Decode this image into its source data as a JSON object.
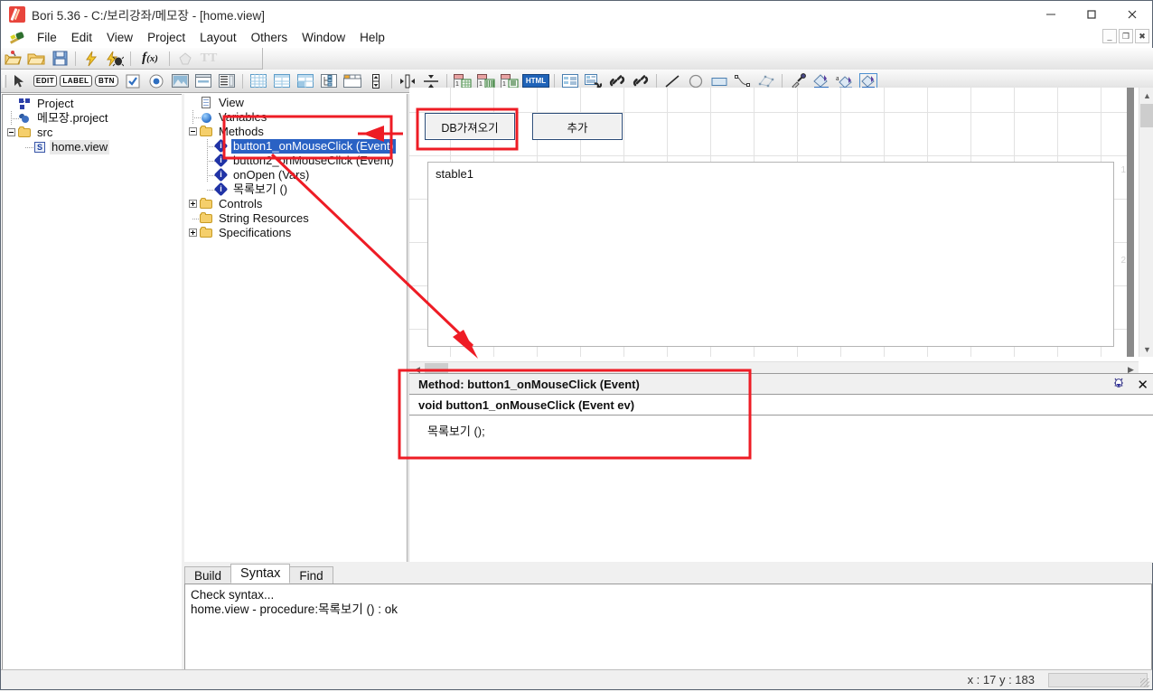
{
  "window": {
    "title": "Bori 5.36 - C:/보리강좌/메모장 - [home.view]",
    "app_icon": "bori-app-icon",
    "minimize": "–",
    "maximize": "□",
    "close": "✕",
    "mdi_minimize": "_",
    "mdi_restore": "❐",
    "mdi_close": "✖"
  },
  "menubar": {
    "icon": "bori-menu-icon",
    "items": [
      "File",
      "Edit",
      "View",
      "Project",
      "Layout",
      "Others",
      "Window",
      "Help"
    ]
  },
  "toolbar_main": [
    {
      "name": "open-project-icon",
      "glyph": "open-project"
    },
    {
      "name": "open-folder-icon",
      "glyph": "folder"
    },
    {
      "name": "save-icon",
      "glyph": "floppy"
    },
    {
      "name": "separator",
      "glyph": "sep"
    },
    {
      "name": "run-icon",
      "glyph": "bolt"
    },
    {
      "name": "debug-icon",
      "glyph": "bolt-bug"
    },
    {
      "name": "separator",
      "glyph": "sep"
    },
    {
      "name": "function-icon",
      "glyph": "fx"
    },
    {
      "name": "separator",
      "glyph": "sep"
    },
    {
      "name": "shape-icon",
      "glyph": "pentagon"
    },
    {
      "name": "text-tool-icon",
      "glyph": "TT"
    }
  ],
  "toolbar_widgets": [
    {
      "name": "pointer-tool-icon",
      "glyph": "arrow"
    },
    {
      "name": "edit-widget-icon",
      "glyph": "EDIT"
    },
    {
      "name": "label-widget-icon",
      "glyph": "LABEL"
    },
    {
      "name": "button-widget-icon",
      "glyph": "BTN"
    },
    {
      "name": "checkbox-widget-icon",
      "glyph": "check"
    },
    {
      "name": "radio-widget-icon",
      "glyph": "radio"
    },
    {
      "name": "image-widget-icon",
      "glyph": "image"
    },
    {
      "name": "panel-widget-icon",
      "glyph": "panel"
    },
    {
      "name": "list-widget-icon",
      "glyph": "list"
    },
    {
      "name": "grid-widget-icon",
      "glyph": "grid1"
    },
    {
      "name": "grid2-widget-icon",
      "glyph": "grid2"
    },
    {
      "name": "grid3-widget-icon",
      "glyph": "grid3"
    },
    {
      "name": "grid4-widget-icon",
      "glyph": "grid4"
    },
    {
      "name": "tree-widget-icon",
      "glyph": "tree"
    },
    {
      "name": "tab-widget-icon",
      "glyph": "tabs"
    },
    {
      "name": "spinner-widget-icon",
      "glyph": "spin"
    },
    {
      "name": "vsplit-widget-icon",
      "glyph": "vsplit"
    },
    {
      "name": "hsplit-widget-icon",
      "glyph": "hsplit"
    },
    {
      "name": "datagrid-widget-icon",
      "glyph": "dg1"
    },
    {
      "name": "datalist-widget-icon",
      "glyph": "dg2"
    },
    {
      "name": "datatext-widget-icon",
      "glyph": "dg3"
    },
    {
      "name": "html-widget-icon",
      "glyph": "HTML"
    },
    {
      "name": "form-widget-icon",
      "glyph": "form"
    },
    {
      "name": "link-data-icon",
      "glyph": "link1"
    },
    {
      "name": "link-icon",
      "glyph": "link2"
    },
    {
      "name": "link-chain-icon",
      "glyph": "link3"
    },
    {
      "name": "line-tool-icon",
      "glyph": "line"
    },
    {
      "name": "ellipse-tool-icon",
      "glyph": "circle"
    },
    {
      "name": "rect-tool-icon",
      "glyph": "rect"
    },
    {
      "name": "curve-tool-icon",
      "glyph": "curve"
    },
    {
      "name": "polygon-tool-icon",
      "glyph": "poly"
    },
    {
      "name": "eyedropper-icon",
      "glyph": "dropper"
    },
    {
      "name": "fill-color-icon",
      "glyph": "bucket1"
    },
    {
      "name": "text-color-icon",
      "glyph": "bucket2"
    },
    {
      "name": "bg-color-icon",
      "glyph": "bucket3"
    }
  ],
  "project_tree": {
    "root": {
      "label": "Project",
      "icon": "project-icon"
    },
    "nodes": [
      {
        "label": "메모장.project",
        "icon": "bori-project-icon",
        "depth": 1
      },
      {
        "label": "src",
        "icon": "folder-icon",
        "depth": 1,
        "expanded": true
      },
      {
        "label": "home.view",
        "icon": "view-file-icon",
        "depth": 2,
        "highlighted": true
      }
    ]
  },
  "view_tree": {
    "root": {
      "label": "View",
      "icon": "document-icon"
    },
    "nodes": [
      {
        "label": "Variables",
        "icon": "sphere-icon",
        "depth": 1
      },
      {
        "label": "Methods",
        "icon": "folder-icon",
        "depth": 1,
        "expanded": true
      },
      {
        "label": "button1_onMouseClick (Event)",
        "icon": "method-icon",
        "depth": 2,
        "selected": true
      },
      {
        "label": "button2_onMouseClick (Event)",
        "icon": "method-icon",
        "depth": 2
      },
      {
        "label": "onOpen (Vars)",
        "icon": "method-icon",
        "depth": 2
      },
      {
        "label": "목록보기 ()",
        "icon": "method-icon",
        "depth": 2
      },
      {
        "label": "Controls",
        "icon": "folder-icon",
        "depth": 1,
        "collapsed": true
      },
      {
        "label": "String Resources",
        "icon": "folder-icon",
        "depth": 1
      },
      {
        "label": "Specifications",
        "icon": "folder-icon",
        "depth": 1,
        "collapsed": true
      }
    ]
  },
  "canvas": {
    "buttons": [
      {
        "label": "DB가져오기",
        "name": "db-import-button",
        "highlighted": true
      },
      {
        "label": "추가",
        "name": "add-button"
      }
    ],
    "table": {
      "label": "stable1",
      "name": "stable1-control"
    },
    "ruler_marks": [
      "1",
      "2"
    ]
  },
  "method_editor": {
    "header": "Method: button1_onMouseClick (Event)",
    "signature": "void button1_onMouseClick (Event ev)",
    "code": "목록보기 ();",
    "debug_icon": "debug-bug-icon",
    "close_icon": "close-icon"
  },
  "output": {
    "tabs": [
      {
        "label": "Build",
        "active": false
      },
      {
        "label": "Syntax",
        "active": true
      },
      {
        "label": "Find",
        "active": false
      }
    ],
    "lines": [
      "Check syntax...",
      "home.view - procedure:목록보기 () : ok"
    ]
  },
  "statusbar": {
    "coords": "x : 17  y : 183"
  },
  "annotation_color": "#ee1c25"
}
